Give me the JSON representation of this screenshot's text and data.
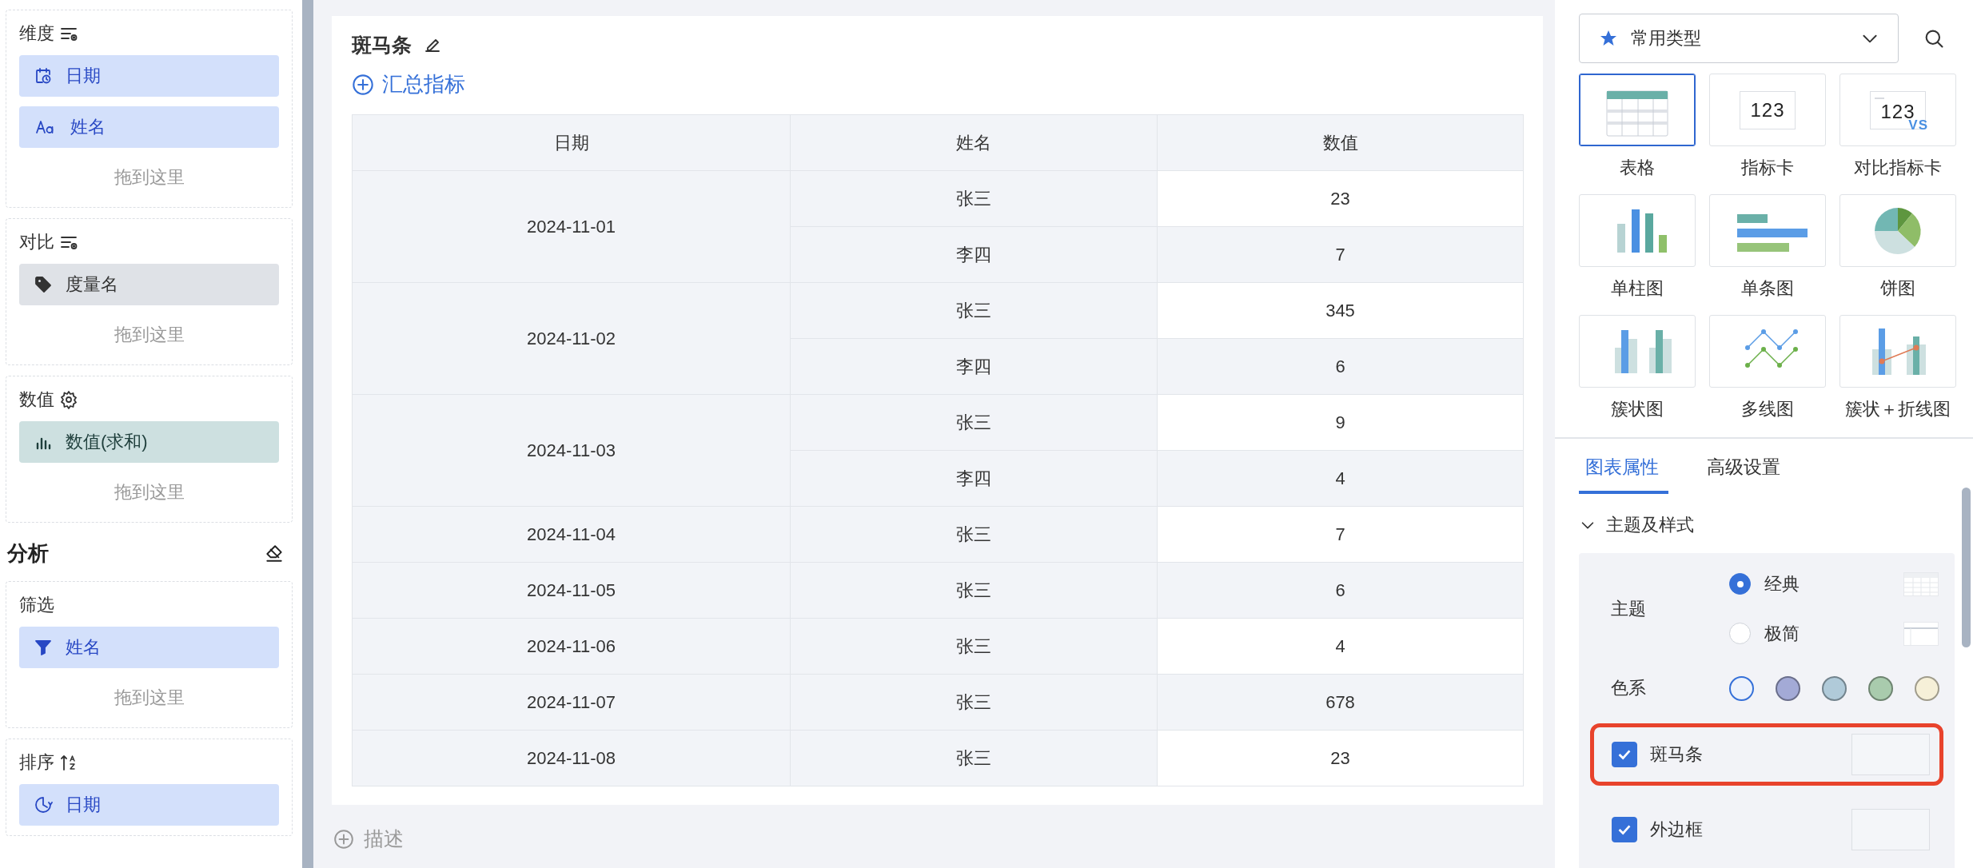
{
  "left_panel": {
    "sections": [
      {
        "kind": "dimension",
        "title": "维度",
        "chips": [
          {
            "kind": "date",
            "label": "日期"
          },
          {
            "kind": "text",
            "label": "姓名"
          }
        ],
        "drop_hint": "拖到这里"
      },
      {
        "kind": "compare",
        "title": "对比",
        "chips": [
          {
            "kind": "tag",
            "label": "度量名"
          }
        ],
        "drop_hint": "拖到这里"
      },
      {
        "kind": "value",
        "title": "数值",
        "chips": [
          {
            "kind": "measure",
            "label": "数值(求和)"
          }
        ],
        "drop_hint": "拖到这里"
      },
      {
        "kind": "heading",
        "title": "分析"
      },
      {
        "kind": "filter",
        "title": "筛选",
        "chips": [
          {
            "kind": "filter",
            "label": "姓名"
          }
        ],
        "drop_hint": "拖到这里"
      },
      {
        "kind": "sort",
        "title": "排序",
        "chips": [
          {
            "kind": "sort",
            "label": "日期"
          }
        ]
      }
    ]
  },
  "card": {
    "title": "斑马条",
    "add_link": "汇总指标",
    "table": {
      "columns": [
        "日期",
        "姓名",
        "数值"
      ],
      "rows": [
        {
          "date": "2024-11-01",
          "entries": [
            {
              "name": "张三",
              "value": "23"
            },
            {
              "name": "李四",
              "value": "7"
            }
          ]
        },
        {
          "date": "2024-11-02",
          "entries": [
            {
              "name": "张三",
              "value": "345"
            },
            {
              "name": "李四",
              "value": "6"
            }
          ]
        },
        {
          "date": "2024-11-03",
          "entries": [
            {
              "name": "张三",
              "value": "9"
            },
            {
              "name": "李四",
              "value": "4"
            }
          ]
        },
        {
          "date": "2024-11-04",
          "entries": [
            {
              "name": "张三",
              "value": "7"
            }
          ]
        },
        {
          "date": "2024-11-05",
          "entries": [
            {
              "name": "张三",
              "value": "6"
            }
          ]
        },
        {
          "date": "2024-11-06",
          "entries": [
            {
              "name": "张三",
              "value": "4"
            }
          ]
        },
        {
          "date": "2024-11-07",
          "entries": [
            {
              "name": "张三",
              "value": "678"
            }
          ]
        },
        {
          "date": "2024-11-08",
          "entries": [
            {
              "name": "张三",
              "value": "23"
            }
          ]
        }
      ]
    }
  },
  "description_link": "描述",
  "right_panel": {
    "type_dropdown": "常用类型",
    "chart_type_rows": [
      {
        "items": [
          {
            "kind": "table",
            "label": "表格",
            "selected": true
          },
          {
            "kind": "kpi",
            "icon_text": "123",
            "label": "指标卡",
            "selected": false
          },
          {
            "kind": "kpi-compare",
            "icon_text": "123",
            "icon_badge": "VS",
            "label": "对比指标卡",
            "selected": false
          }
        ]
      },
      {
        "items": [
          {
            "kind": "column",
            "label": "单柱图",
            "selected": false
          },
          {
            "kind": "bar",
            "label": "单条图",
            "selected": false
          },
          {
            "kind": "pie",
            "label": "饼图",
            "selected": false
          }
        ]
      },
      {
        "items": [
          {
            "kind": "cluster",
            "label": "簇状图",
            "selected": false
          },
          {
            "kind": "multiline",
            "label": "多线图",
            "selected": false
          },
          {
            "kind": "combo",
            "label": "簇状＋折线图",
            "selected": false
          }
        ]
      }
    ],
    "tabs": [
      {
        "label": "图表属性",
        "selected": true
      },
      {
        "label": "高级设置",
        "selected": false
      }
    ],
    "section": {
      "title": "主题及样式",
      "expanded": true,
      "theme": {
        "label": "主题",
        "options": [
          {
            "kind": "classic",
            "label": "经典",
            "selected": true
          },
          {
            "kind": "minimal",
            "label": "极简",
            "selected": false
          }
        ]
      },
      "palette": {
        "label": "色系",
        "swatches": [
          {
            "color": "#edf2fb",
            "selected": true
          },
          {
            "color": "#a3aad6",
            "selected": false
          },
          {
            "color": "#b0cad9",
            "selected": false
          },
          {
            "color": "#a9cbad",
            "selected": false
          },
          {
            "color": "#f6f0d8",
            "selected": false
          }
        ]
      },
      "toggles": [
        {
          "label": "斑马条",
          "checked": true,
          "highlighted": true
        },
        {
          "label": "外边框",
          "checked": true,
          "highlighted": false
        }
      ]
    }
  }
}
